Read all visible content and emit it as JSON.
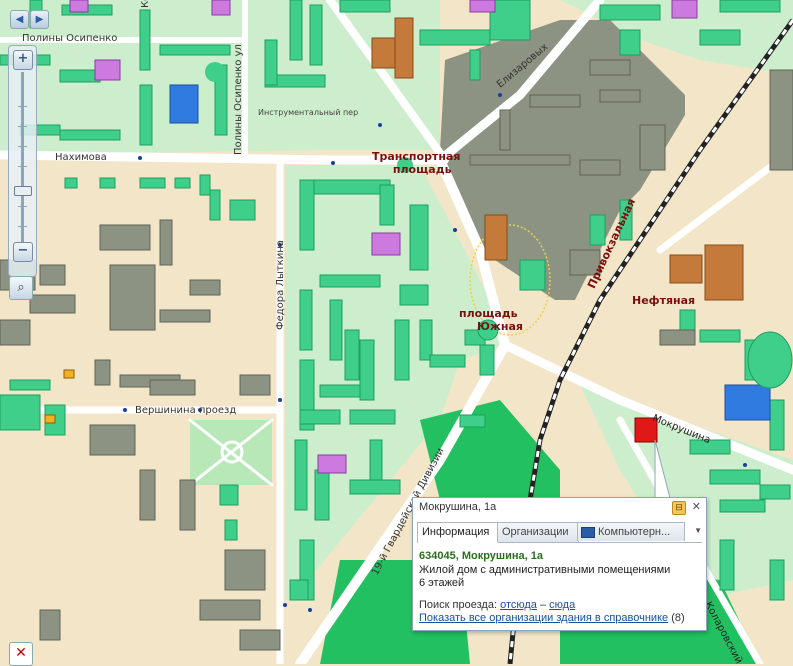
{
  "map": {
    "streets": {
      "polin_osipenko_h": "Полины Осипенко",
      "kotov": "Котов",
      "polin_osipenko_v": "Полины Осипенко ул",
      "instrumentalny": "Инструментальный пер",
      "nakhimova": "Нахимова",
      "elizarovykh": "Елизаровых",
      "fedora_lytkina": "Федора Лыткина",
      "vershinina": "Вершинина проезд",
      "gvardeiskoi": "19-й Гвардейской Дивизии",
      "privokzalnaya": "Привокзальная",
      "neftyanaya": "Нефтяная",
      "mokrushina": "Мокрушина",
      "kolarovsky": "Коларовский"
    },
    "squares": {
      "transportnaya": [
        "Транспортная",
        "площадь"
      ],
      "yuzhnaya": [
        "площадь",
        "Южная"
      ]
    }
  },
  "nav": {
    "left_arrow": "◀",
    "right_arrow": "▶",
    "zoom_in": "+",
    "zoom_out": "−",
    "zoom_select": "⌕",
    "corner": "✕"
  },
  "popup": {
    "title": "Мокрушина, 1а",
    "tabs": [
      "Информация",
      "Организации",
      "Компьютерн..."
    ],
    "address": "634045, Мокрушина, 1а",
    "description": "Жилой дом с административными помещениями",
    "floors": "6 этажей",
    "route_label": "Поиск проезда:",
    "route_from": "отсюда",
    "route_dash": " – ",
    "route_to": "сюда",
    "all_orgs_link": "Показать все организации здания в справочнике",
    "all_orgs_count": "(8)"
  },
  "colors": {
    "building": "#3fcf8a",
    "building_dark": "#1e9e60",
    "residential_block": "#cdeecd",
    "road": "#ffffff",
    "industrial": "#8d9382",
    "land": "#f3e6c8",
    "accent_blue": "#2a5da8",
    "marker": "#e01818"
  }
}
